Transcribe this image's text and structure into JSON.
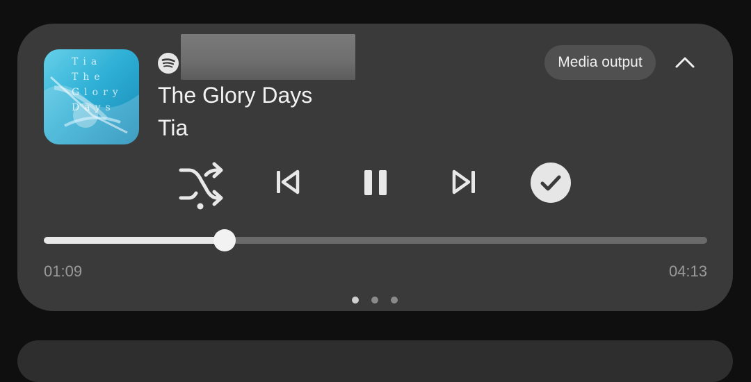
{
  "media_player": {
    "app_icon": "spotify-icon",
    "title": "The Glory Days",
    "artist": "Tia",
    "album_art": {
      "text_lines": [
        "Tia",
        "The",
        "Glory",
        "Days"
      ]
    },
    "output_button_label": "Media output",
    "collapse_icon": "chevron-up-icon",
    "controls": {
      "shuffle_icon": "shuffle-icon",
      "previous_icon": "skip-previous-icon",
      "play_pause_icon": "pause-icon",
      "next_icon": "skip-next-icon",
      "like_icon": "check-circle-icon"
    },
    "progress": {
      "elapsed": "01:09",
      "total": "04:13",
      "fraction": 0.273
    },
    "pager": {
      "pages": 3,
      "active": 0
    }
  },
  "colors": {
    "card_background": "#3a3a3a",
    "screen_background": "#0f0f10",
    "accent_light": "#e8e8e8",
    "track_dim": "#6a6a6a"
  }
}
